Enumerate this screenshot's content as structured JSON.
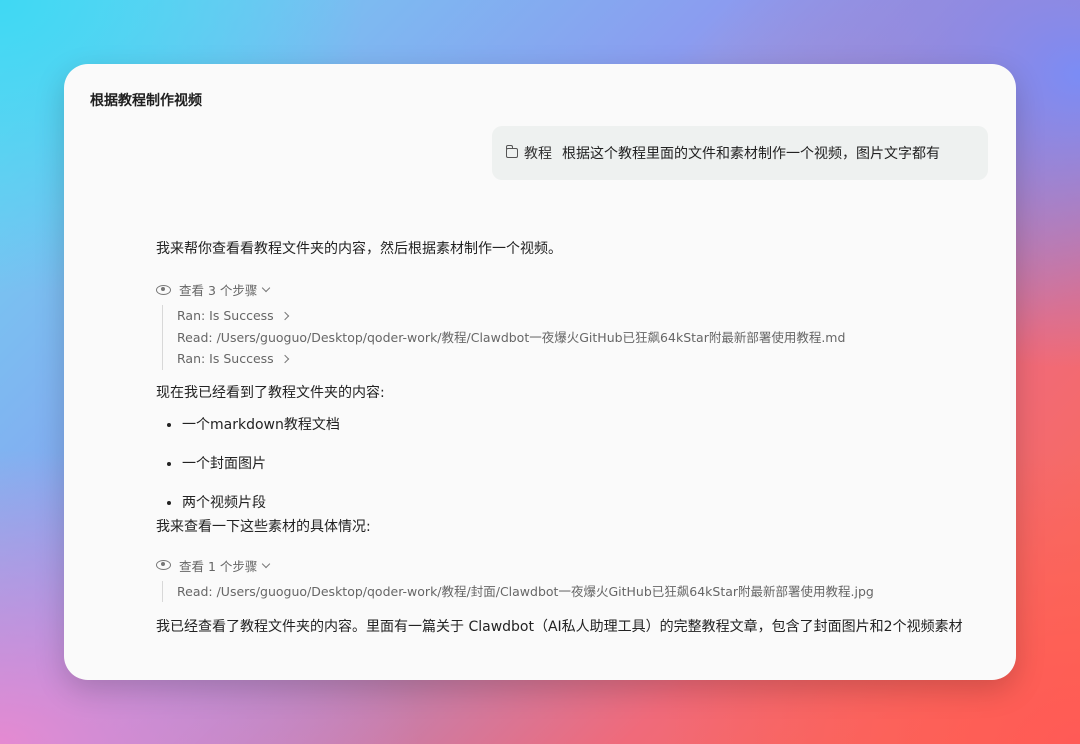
{
  "window": {
    "title": "根据教程制作视频"
  },
  "user_message": {
    "chip_label": "教程",
    "text": "根据这个教程里面的文件和素材制作一个视频，图片文字都有"
  },
  "assistant": {
    "intro": "我来帮你查看看教程文件夹的内容，然后根据素材制作一个视频。",
    "steps_group_1": {
      "label": "查看 3 个步骤",
      "steps": [
        "Ran: Is Success",
        "Read: /Users/guoguo/Desktop/qoder-work/教程/Clawdbot一夜爆火GitHub已狂飙64kStar附最新部署使用教程.md",
        "Ran: Is Success"
      ]
    },
    "summary": "现在我已经看到了教程文件夹的内容:",
    "bullets": [
      "一个markdown教程文档",
      "一个封面图片",
      "两个视频片段"
    ],
    "next": "我来查看一下这些素材的具体情况:",
    "steps_group_2": {
      "label": "查看 1 个步骤",
      "steps": [
        "Read: /Users/guoguo/Desktop/qoder-work/教程/封面/Clawdbot一夜爆火GitHub已狂飙64kStar附最新部署使用教程.jpg"
      ]
    },
    "final": "我已经查看了教程文件夹的内容。里面有一篇关于 Clawdbot（AI私人助理工具）的完整教程文章，包含了封面图片和2个视频素材"
  }
}
